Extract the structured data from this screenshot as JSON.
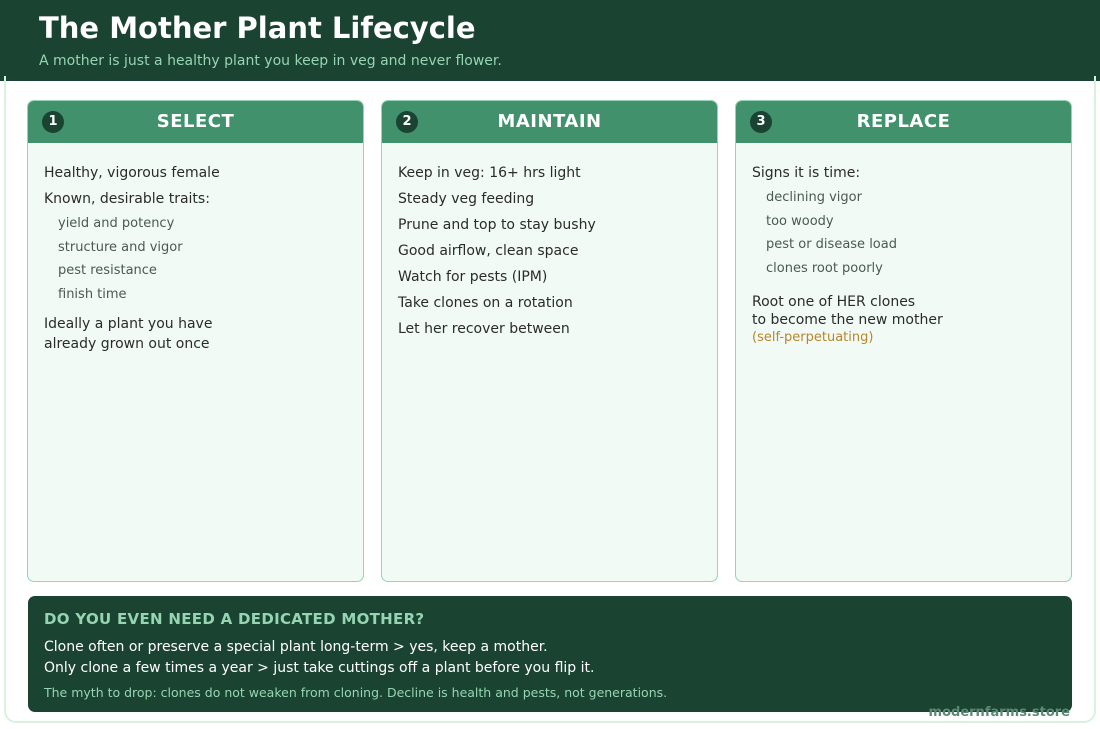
{
  "header": {
    "title": "The Mother Plant Lifecycle",
    "subtitle": "A mother is just a healthy plant you keep in veg and never flower."
  },
  "cards": [
    {
      "number": "1",
      "title": "SELECT",
      "lines": {
        "a": "Healthy, vigorous female",
        "b": "Known, desirable traits:",
        "subs": [
          "yield and potency",
          "structure and vigor",
          "pest resistance",
          "finish time"
        ],
        "c1": "Ideally a plant you have",
        "c2": "already grown out once"
      }
    },
    {
      "number": "2",
      "title": "MAINTAIN",
      "lines": [
        "Keep in veg: 16+ hrs light",
        "Steady veg feeding",
        "Prune and top to stay bushy",
        "Good airflow, clean space",
        "Watch for pests (IPM)",
        "Take clones on a rotation",
        "Let her recover between"
      ]
    },
    {
      "number": "3",
      "title": "REPLACE",
      "lines": {
        "a": "Signs it is time:",
        "subs": [
          "declining vigor",
          "too woody",
          "pest or disease load",
          "clones root poorly"
        ],
        "c1": "Root one of HER clones",
        "c2": "to become the new mother",
        "accent": "(self-perpetuating)"
      }
    }
  ],
  "bottom": {
    "title": "DO YOU EVEN NEED A DEDICATED MOTHER?",
    "line1": "Clone often or preserve a special plant long-term > yes, keep a mother.",
    "line2": "Only clone a few times a year > just take cuttings off a plant before you flip it.",
    "note": "The myth to drop: clones do not weaken from cloning. Decline is health and pests, not generations."
  },
  "watermark": "modernfarms.store",
  "colors": {
    "header_bg": "#1b4332",
    "card_header": "#40916c",
    "card_bg": "#f1faf4",
    "accent_green": "#95d5b2",
    "accent_gold": "#b8862b"
  }
}
